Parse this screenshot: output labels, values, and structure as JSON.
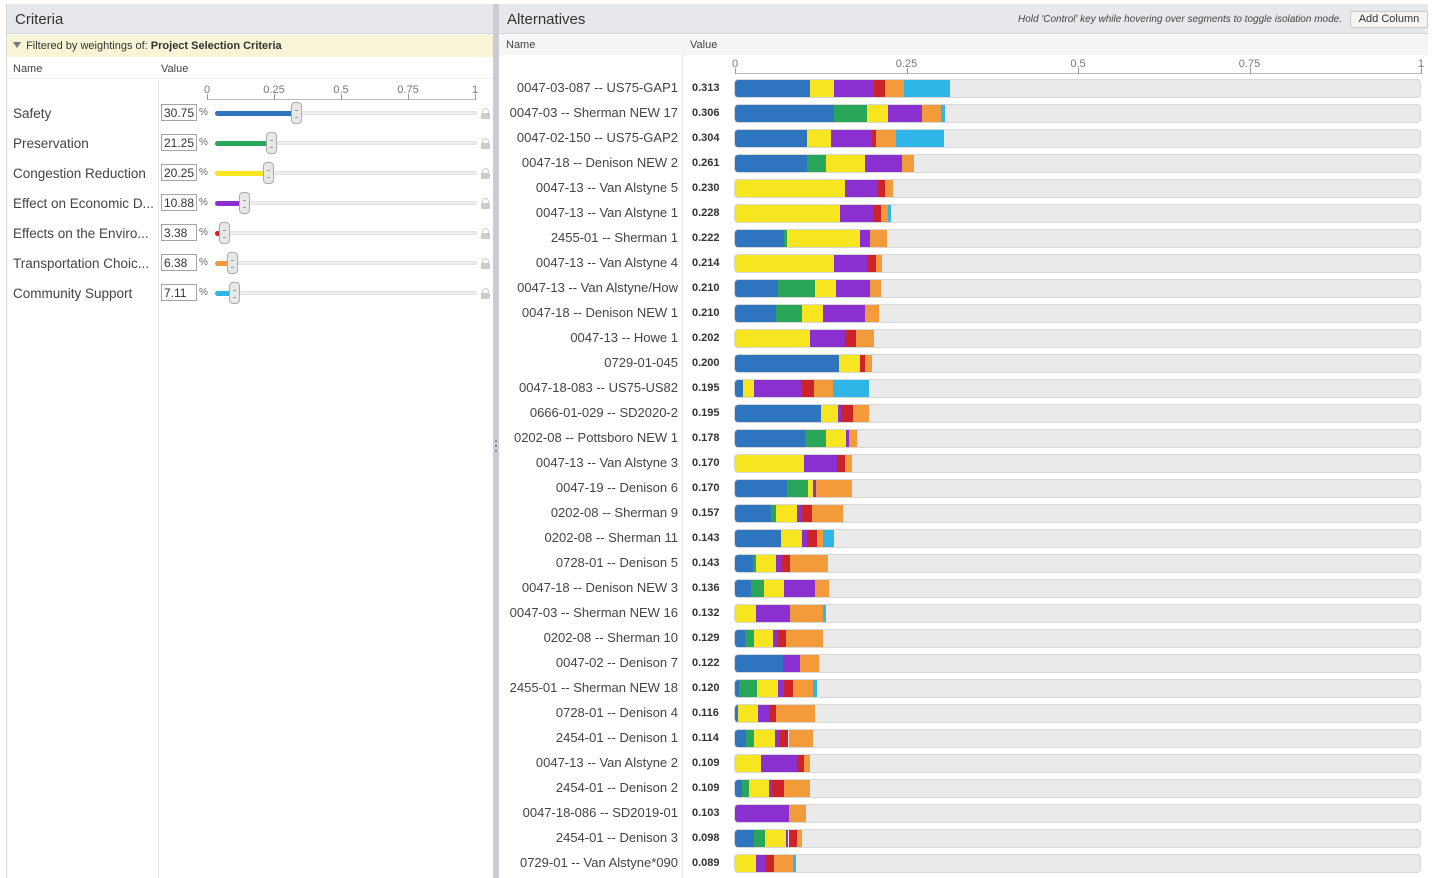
{
  "colors": {
    "safety": "#2f74bf",
    "preservation": "#2aa65a",
    "congestion": "#f7e520",
    "economic": "#8a2fd0",
    "environment": "#cc2229",
    "transport": "#f39a3b",
    "community": "#2fb5e8"
  },
  "criteria": {
    "title": "Criteria",
    "filter_prefix": "Filtered by weightings of:",
    "filter_value": "Project Selection Criteria",
    "col_name": "Name",
    "col_value": "Value",
    "scale_ticks": [
      "0",
      "0.25",
      "0.5",
      "0.75",
      "1"
    ],
    "pct": "%",
    "items": [
      {
        "key": "safety",
        "label": "Safety",
        "value": "30.75",
        "weight": 0.3075
      },
      {
        "key": "preservation",
        "label": "Preservation",
        "value": "21.25",
        "weight": 0.2125
      },
      {
        "key": "congestion",
        "label": "Congestion Reduction",
        "value": "20.25",
        "weight": 0.2025
      },
      {
        "key": "economic",
        "label": "Effect on Economic D...",
        "value": "10.88",
        "weight": 0.1088
      },
      {
        "key": "environment",
        "label": "Effects on the Enviro...",
        "value": "3.38",
        "weight": 0.0338
      },
      {
        "key": "transport",
        "label": "Transportation Choic...",
        "value": "6.38",
        "weight": 0.0638
      },
      {
        "key": "community",
        "label": "Community Support",
        "value": "7.11",
        "weight": 0.0711
      }
    ]
  },
  "alternatives": {
    "title": "Alternatives",
    "hint": "Hold 'Control' key while hovering over segments to toggle isolation mode.",
    "add_column": "Add Column",
    "col_name": "Name",
    "col_value": "Value",
    "scale_ticks": [
      "0",
      "0.25",
      "0.5",
      "0.75",
      "1"
    ]
  },
  "chart_data": {
    "type": "bar",
    "stacked": true,
    "xlim": [
      0,
      1
    ],
    "series_order": [
      "safety",
      "preservation",
      "congestion",
      "economic",
      "environment",
      "transport",
      "community"
    ],
    "rows": [
      {
        "name": "0047-03-087 -- US75-GAP1",
        "value": "0.313",
        "segs": [
          0.11,
          0,
          0.035,
          0.058,
          0.015,
          0.028,
          0.067
        ]
      },
      {
        "name": "0047-03 -- Sherman NEW 17",
        "value": "0.306",
        "segs": [
          0.145,
          0.048,
          0.03,
          0.05,
          0,
          0.028,
          0.005
        ]
      },
      {
        "name": "0047-02-150 -- US75-GAP2",
        "value": "0.304",
        "segs": [
          0.105,
          0,
          0.035,
          0.06,
          0.005,
          0.03,
          0.069
        ]
      },
      {
        "name": "0047-18 -- Denison NEW 2",
        "value": "0.261",
        "segs": [
          0.105,
          0.028,
          0.057,
          0.053,
          0,
          0.018,
          0
        ]
      },
      {
        "name": "0047-13 -- Van Alstyne 5",
        "value": "0.230",
        "segs": [
          0,
          0,
          0.16,
          0.048,
          0.01,
          0.012,
          0
        ]
      },
      {
        "name": "0047-13 -- Van Alstyne 1",
        "value": "0.228",
        "segs": [
          0,
          0,
          0.153,
          0.048,
          0.012,
          0.01,
          0.005
        ]
      },
      {
        "name": "2455-01 -- Sherman 1",
        "value": "0.222",
        "segs": [
          0.072,
          0.004,
          0.106,
          0.015,
          0,
          0.025,
          0
        ]
      },
      {
        "name": "0047-13 -- Van Alstyne 4",
        "value": "0.214",
        "segs": [
          0,
          0,
          0.145,
          0.048,
          0.012,
          0.009,
          0
        ]
      },
      {
        "name": "0047-13 -- Van Alstyne/How",
        "value": "0.210",
        "segs": [
          0.062,
          0.055,
          0.03,
          0.05,
          0,
          0.016,
          0
        ]
      },
      {
        "name": "0047-18 -- Denison NEW 1",
        "value": "0.210",
        "segs": [
          0.06,
          0.038,
          0.03,
          0.062,
          0,
          0.02,
          0
        ]
      },
      {
        "name": "0047-13 -- Howe 1",
        "value": "0.202",
        "segs": [
          0,
          0,
          0.11,
          0.05,
          0.017,
          0.025,
          0
        ]
      },
      {
        "name": "0729-01-045",
        "value": "0.200",
        "segs": [
          0.152,
          0,
          0.03,
          0,
          0.008,
          0.01,
          0
        ]
      },
      {
        "name": "0047-18-083 -- US75-US82",
        "value": "0.195",
        "segs": [
          0.012,
          0,
          0.015,
          0.07,
          0.018,
          0.028,
          0.052
        ]
      },
      {
        "name": "0666-01-029 -- SD2020-2",
        "value": "0.195",
        "segs": [
          0.125,
          0,
          0.025,
          0.004,
          0.018,
          0.023,
          0
        ]
      },
      {
        "name": "0202-08 -- Pottsboro NEW 1",
        "value": "0.178",
        "segs": [
          0.102,
          0.03,
          0.03,
          0.004,
          0,
          0.012,
          0
        ]
      },
      {
        "name": "0047-13 -- Van Alstyne 3",
        "value": "0.170",
        "segs": [
          0,
          0,
          0.1,
          0.048,
          0.012,
          0.01,
          0
        ]
      },
      {
        "name": "0047-19 -- Denison 6",
        "value": "0.170",
        "segs": [
          0.076,
          0.03,
          0.008,
          0.004,
          0,
          0.052,
          0
        ]
      },
      {
        "name": "0202-08 -- Sherman 9",
        "value": "0.157",
        "segs": [
          0.052,
          0.008,
          0.03,
          0.008,
          0.014,
          0.045,
          0
        ]
      },
      {
        "name": "0202-08 -- Sherman 11",
        "value": "0.143",
        "segs": [
          0.067,
          0,
          0.03,
          0.008,
          0.014,
          0.01,
          0.016
        ]
      },
      {
        "name": "0728-01 -- Denison 5",
        "value": "0.143",
        "segs": [
          0.026,
          0.004,
          0.03,
          0.008,
          0.012,
          0.055,
          0
        ]
      },
      {
        "name": "0047-18 -- Denison NEW 3",
        "value": "0.136",
        "segs": [
          0.024,
          0.018,
          0.03,
          0.045,
          0,
          0.02,
          0
        ]
      },
      {
        "name": "0047-03 -- Sherman NEW 16",
        "value": "0.132",
        "segs": [
          0,
          0,
          0.03,
          0.05,
          0,
          0.048,
          0.004
        ]
      },
      {
        "name": "0202-08 -- Sherman 10",
        "value": "0.129",
        "segs": [
          0.015,
          0.012,
          0.028,
          0.008,
          0.012,
          0.054,
          0
        ]
      },
      {
        "name": "0047-02 -- Denison 7",
        "value": "0.122",
        "segs": [
          0.07,
          0,
          0,
          0.025,
          0,
          0.027,
          0
        ]
      },
      {
        "name": "2455-01 -- Sherman NEW 18",
        "value": "0.120",
        "segs": [
          0.006,
          0.026,
          0.03,
          0.01,
          0.012,
          0.03,
          0.006
        ]
      },
      {
        "name": "0728-01 -- Denison 4",
        "value": "0.116",
        "segs": [
          0.004,
          0,
          0.03,
          0.016,
          0.01,
          0.056,
          0
        ]
      },
      {
        "name": "2454-01 -- Denison 1",
        "value": "0.114",
        "segs": [
          0.016,
          0.012,
          0.03,
          0.008,
          0.012,
          0.036,
          0
        ]
      },
      {
        "name": "0047-13 -- Van Alstyne 2",
        "value": "0.109",
        "segs": [
          0,
          0,
          0.038,
          0.052,
          0.01,
          0.009,
          0
        ]
      },
      {
        "name": "2454-01 -- Denison 2",
        "value": "0.109",
        "segs": [
          0.01,
          0.01,
          0.03,
          0.004,
          0.018,
          0.037,
          0
        ]
      },
      {
        "name": "0047-18-086 -- SD2019-01",
        "value": "0.103",
        "segs": [
          0,
          0,
          0,
          0.078,
          0,
          0.025,
          0
        ]
      },
      {
        "name": "2454-01 -- Denison 3",
        "value": "0.098",
        "segs": [
          0.028,
          0.016,
          0.03,
          0.004,
          0.012,
          0.008,
          0
        ]
      },
      {
        "name": "0729-01 -- Van Alstyne*090",
        "value": "0.089",
        "segs": [
          0,
          0,
          0.03,
          0.015,
          0.012,
          0.027,
          0.005
        ]
      }
    ]
  }
}
